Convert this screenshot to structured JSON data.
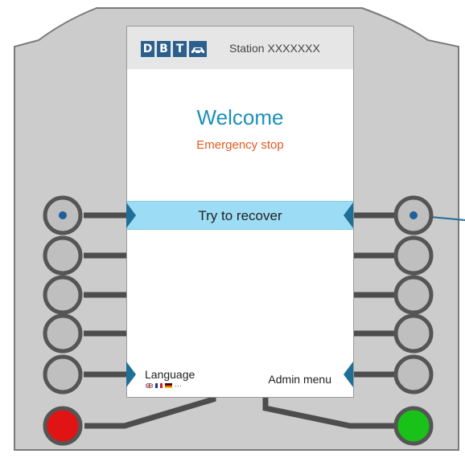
{
  "header": {
    "logo_letters": [
      "D",
      "B",
      "T"
    ],
    "logo_icon": "car-icon",
    "station": "Station XXXXXXX"
  },
  "main": {
    "title": "Welcome",
    "status": "Emergency stop"
  },
  "options": {
    "recover_label": "Try to recover",
    "language_label": "Language",
    "language_more": "···",
    "language_flags": [
      "uk-flag-icon",
      "france-flag-icon",
      "germany-flag-icon"
    ],
    "admin_label": "Admin menu"
  },
  "colors": {
    "accent": "#1d8fb8",
    "status": "#e05a1e",
    "highlight": "#9cdcf5",
    "logo": "#2b5f8e",
    "stop_button": "#e01414",
    "go_button": "#19c219",
    "housing": "#cccccc",
    "connector_arrow": "#1f6f96"
  }
}
